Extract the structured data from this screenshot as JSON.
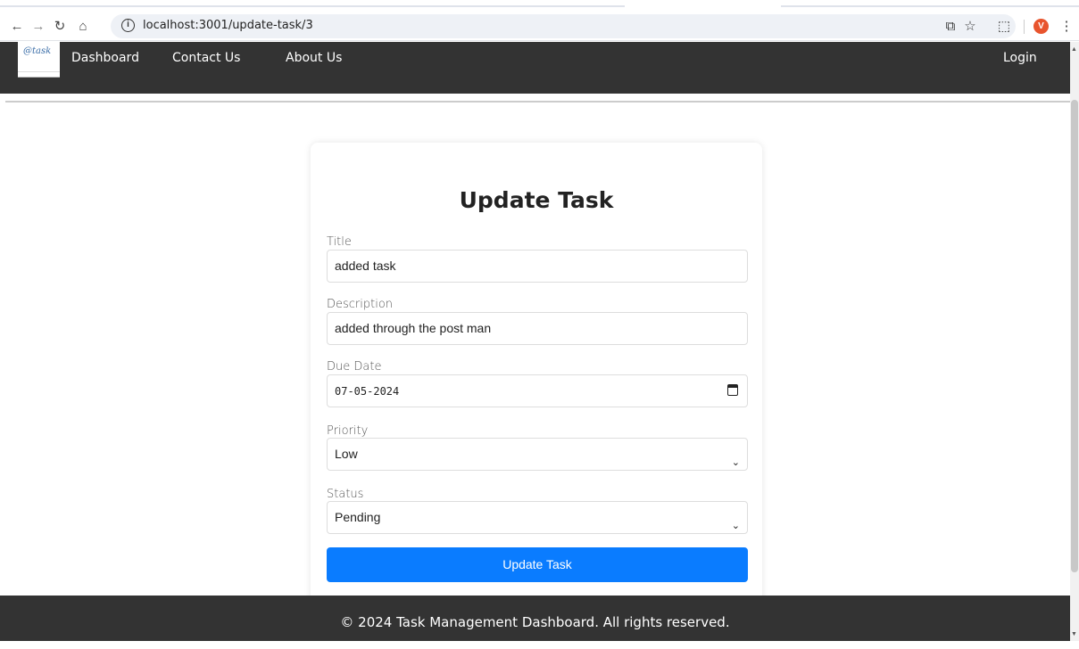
{
  "browser": {
    "url": "localhost:3001/update-task/3",
    "profile_initial": "V",
    "icons": [
      "back-icon",
      "forward-icon",
      "reload-icon",
      "home-icon",
      "site-info-icon",
      "install-app-icon",
      "bookmark-star-icon",
      "extensions-icon",
      "menu-kebab-icon"
    ]
  },
  "navbar": {
    "logo_text": "@task",
    "links": [
      "Dashboard",
      "Contact Us",
      "About Us"
    ],
    "login": "Login"
  },
  "form": {
    "heading": "Update Task",
    "title_label": "Title",
    "title_value": "added task",
    "description_label": "Description",
    "description_value": "added through the post man",
    "due_date_label": "Due Date",
    "due_date_value": "07-05-2024",
    "priority_label": "Priority",
    "priority_value": "Low",
    "status_label": "Status",
    "status_value": "Pending",
    "submit_label": "Update Task"
  },
  "footer": {
    "text": "© 2024 Task Management Dashboard. All rights reserved."
  },
  "colors": {
    "navbar_bg": "#333333",
    "button_bg": "#0a7cff",
    "footer_bg": "#333333"
  }
}
